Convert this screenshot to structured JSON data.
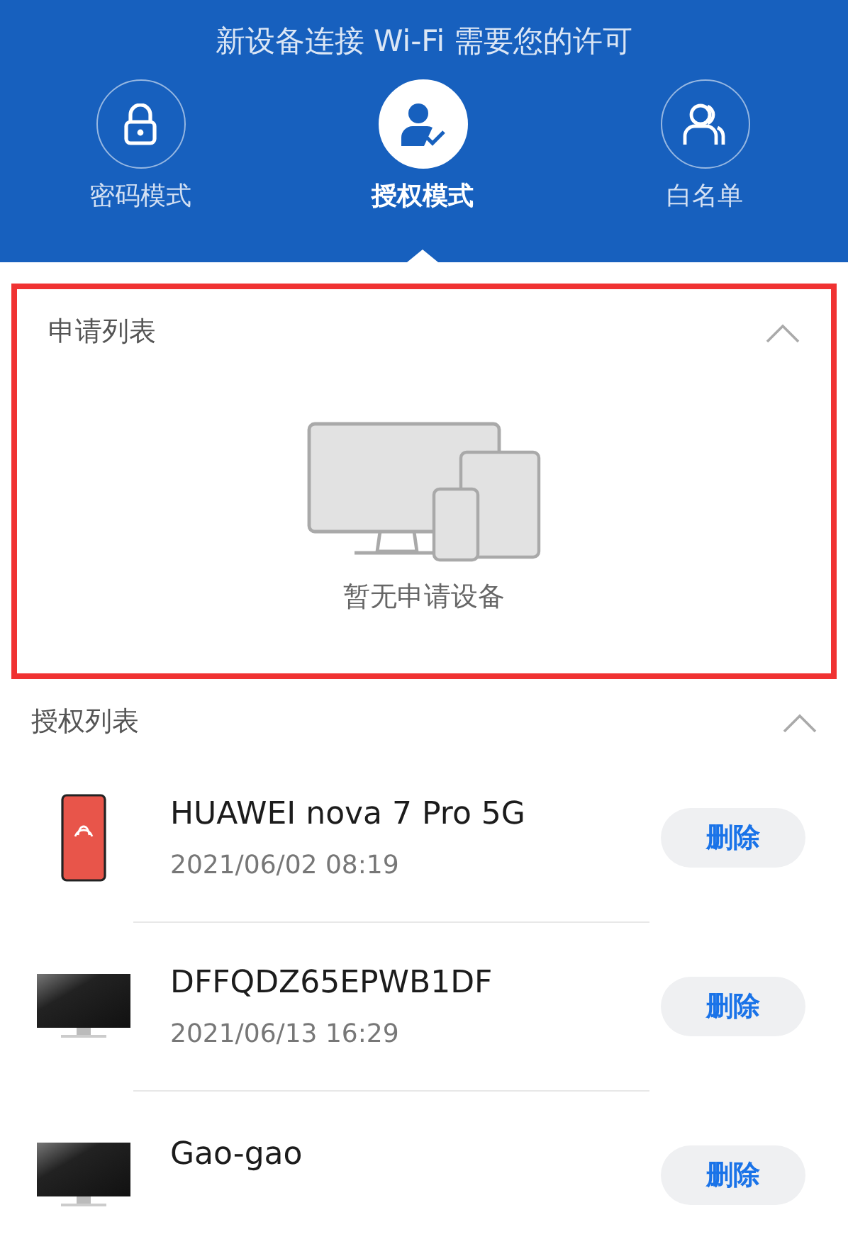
{
  "header": {
    "title": "新设备连接 Wi-Fi 需要您的许可"
  },
  "modes": [
    {
      "label": "密码模式",
      "kind": "lock",
      "selected": false
    },
    {
      "label": "授权模式",
      "kind": "user-check",
      "selected": true
    },
    {
      "label": "白名单",
      "kind": "users",
      "selected": false
    }
  ],
  "request_list": {
    "title": "申请列表",
    "expanded": true,
    "highlighted": true,
    "empty_text": "暂无申请设备"
  },
  "authorized_list": {
    "title": "授权列表",
    "expanded": true,
    "devices": [
      {
        "kind": "phone",
        "name": "HUAWEI nova 7 Pro 5G",
        "time": "2021/06/02 08:19",
        "action": "删除"
      },
      {
        "kind": "monitor",
        "name": "DFFQDZ65EPWB1DF",
        "time": "2021/06/13 16:29",
        "action": "删除"
      },
      {
        "kind": "monitor",
        "name": "Gao-gao",
        "action": "删除"
      }
    ]
  }
}
